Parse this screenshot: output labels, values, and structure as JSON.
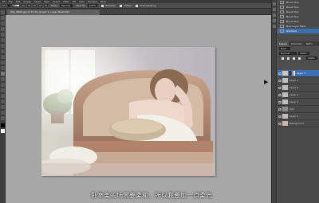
{
  "app": {
    "menu_items": [
      "PS",
      "File",
      "Edit",
      "Image",
      "Layer",
      "Type",
      "Select",
      "Filter",
      "3D",
      "View",
      "Window",
      "Help"
    ]
  },
  "options_bar": {
    "mode_label": "Mode:",
    "mode_value": "Normal",
    "opacity_label": "Opacity:",
    "opacity_value": "100%",
    "flow_label": "Flow:",
    "flow_value": "100%",
    "reverse_label": "Reverse",
    "dither_label": "Dither",
    "transparency_label": "Transparency"
  },
  "document": {
    "tab_title": "IMG_8896.jpg @ 33.3% (Layer 3, Layer Mask/16)*",
    "close_glyph": "×"
  },
  "history": {
    "items": [
      "Brush Tool",
      "Brush Tool",
      "Brush Tool",
      "Brush Tool",
      "Brush Tool",
      "New Layer Mask",
      "Gradient"
    ],
    "active_index": 6
  },
  "layers_panel": {
    "tabs": [
      "Layers",
      "Channels",
      "Paths"
    ],
    "kind_label": "Kind",
    "blend_mode": "Normal",
    "opacity_value": "100%",
    "fill_value": "100%",
    "layers": [
      {
        "name": "Layer 3",
        "has_mask": true,
        "active": true
      },
      {
        "name": "Layer 1",
        "has_mask": false,
        "active": false
      },
      {
        "name": "Layer 2",
        "has_mask": false,
        "active": false
      },
      {
        "name": "Layer 2",
        "has_mask": false,
        "active": false
      },
      {
        "name": "Layer 1",
        "has_mask": false,
        "active": false
      },
      {
        "name": "skin",
        "has_mask": false,
        "active": false
      },
      {
        "name": "Layer 1",
        "has_mask": false,
        "active": false
      },
      {
        "name": "Background",
        "has_mask": false,
        "active": false
      }
    ]
  },
  "subtitle": {
    "text": "卧室类的场景要柔和，所以我要加一点柔光"
  }
}
